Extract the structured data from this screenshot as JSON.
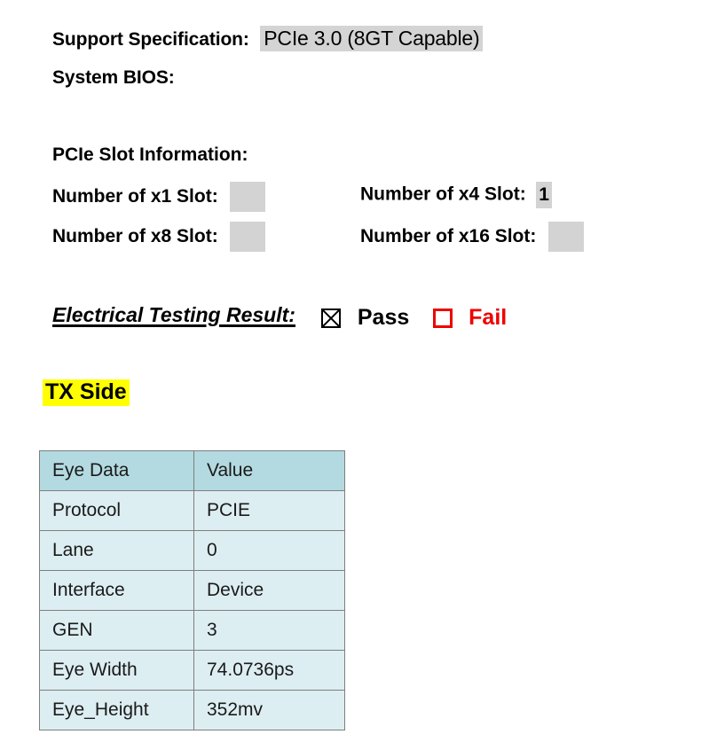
{
  "spec": {
    "support_spec_label": "Support Specification:",
    "support_spec_value": "PCIe 3.0 (8GT Capable)",
    "system_bios_label": "System BIOS:",
    "system_bios_value": ""
  },
  "slot_info": {
    "heading": "PCIe Slot Information:",
    "rows": [
      {
        "left_label": "Number of x1 Slot:",
        "left_value": "",
        "right_label": "Number of x4 Slot:",
        "right_value": "1"
      },
      {
        "left_label": "Number of x8 Slot:",
        "left_value": "",
        "right_label": "Number of x16 Slot:",
        "right_value": ""
      }
    ]
  },
  "electrical_result": {
    "title": "Electrical Testing Result:",
    "pass_label": "Pass",
    "pass_checked": true,
    "fail_label": "Fail",
    "fail_checked": false,
    "pass_color": "#000000",
    "fail_color": "#ee0000"
  },
  "tx_section": {
    "heading": "TX Side",
    "heading_highlight_color": "#ffff00"
  },
  "eye_table": {
    "header": [
      "Eye Data",
      "Value"
    ],
    "rows": [
      [
        "Protocol",
        "PCIE"
      ],
      [
        "Lane",
        "0"
      ],
      [
        "Interface",
        "Device"
      ],
      [
        "GEN",
        "3"
      ],
      [
        "Eye Width",
        "74.0736ps"
      ],
      [
        "Eye_Height",
        "352mv"
      ]
    ],
    "header_bg": "#b3dae0",
    "row_bg": "#ddeef2",
    "border_color": "#7e7e7e"
  }
}
